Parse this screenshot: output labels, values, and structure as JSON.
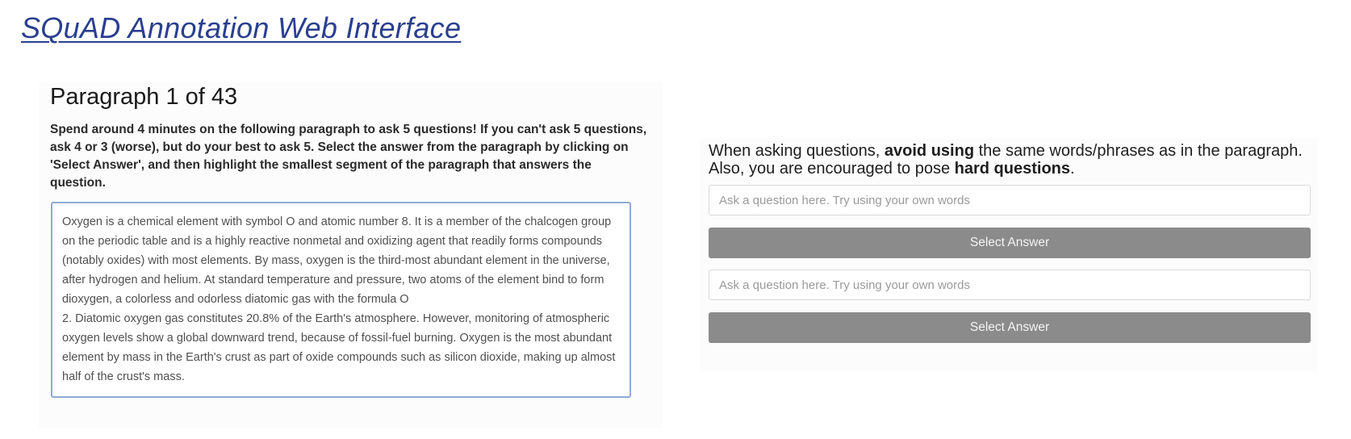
{
  "header": {
    "title": "SQuAD Annotation Web Interface"
  },
  "left": {
    "heading": "Paragraph 1 of 43",
    "instructions": "Spend around 4 minutes on the following paragraph to ask 5 questions! If you can't ask 5 questions, ask 4 or 3 (worse), but do your best to ask 5. Select the answer from the paragraph by clicking on 'Select Answer', and then highlight the smallest segment of the paragraph that answers the question.",
    "paragraph_lines": [
      "Oxygen is a chemical element with symbol O and atomic number 8. It is a member of the chalcogen group on the periodic table and is a highly reactive nonmetal and oxidizing agent that readily forms compounds (notably oxides) with most elements. By mass, oxygen is the third-most abundant element in the universe, after hydrogen and helium. At standard temperature and pressure, two atoms of the element bind to form dioxygen, a colorless and odorless diatomic gas with the formula O",
      "2. Diatomic oxygen gas constitutes 20.8% of the Earth's atmosphere. However, monitoring of atmospheric oxygen levels show a global downward trend, because of fossil-fuel burning. Oxygen is the most abundant element by mass in the Earth's crust as part of oxide compounds such as silicon dioxide, making up almost half of the crust's mass."
    ]
  },
  "right": {
    "guidance": {
      "part1": "When asking questions, ",
      "bold1": "avoid using",
      "part2": " the same words/phrases as in the paragraph. Also, you are encouraged to pose ",
      "bold2": "hard questions",
      "part3": "."
    },
    "questions": [
      {
        "placeholder": "Ask a question here. Try using your own words",
        "value": "",
        "button_label": "Select Answer"
      },
      {
        "placeholder": "Ask a question here. Try using your own words",
        "value": "",
        "button_label": "Select Answer"
      }
    ]
  }
}
